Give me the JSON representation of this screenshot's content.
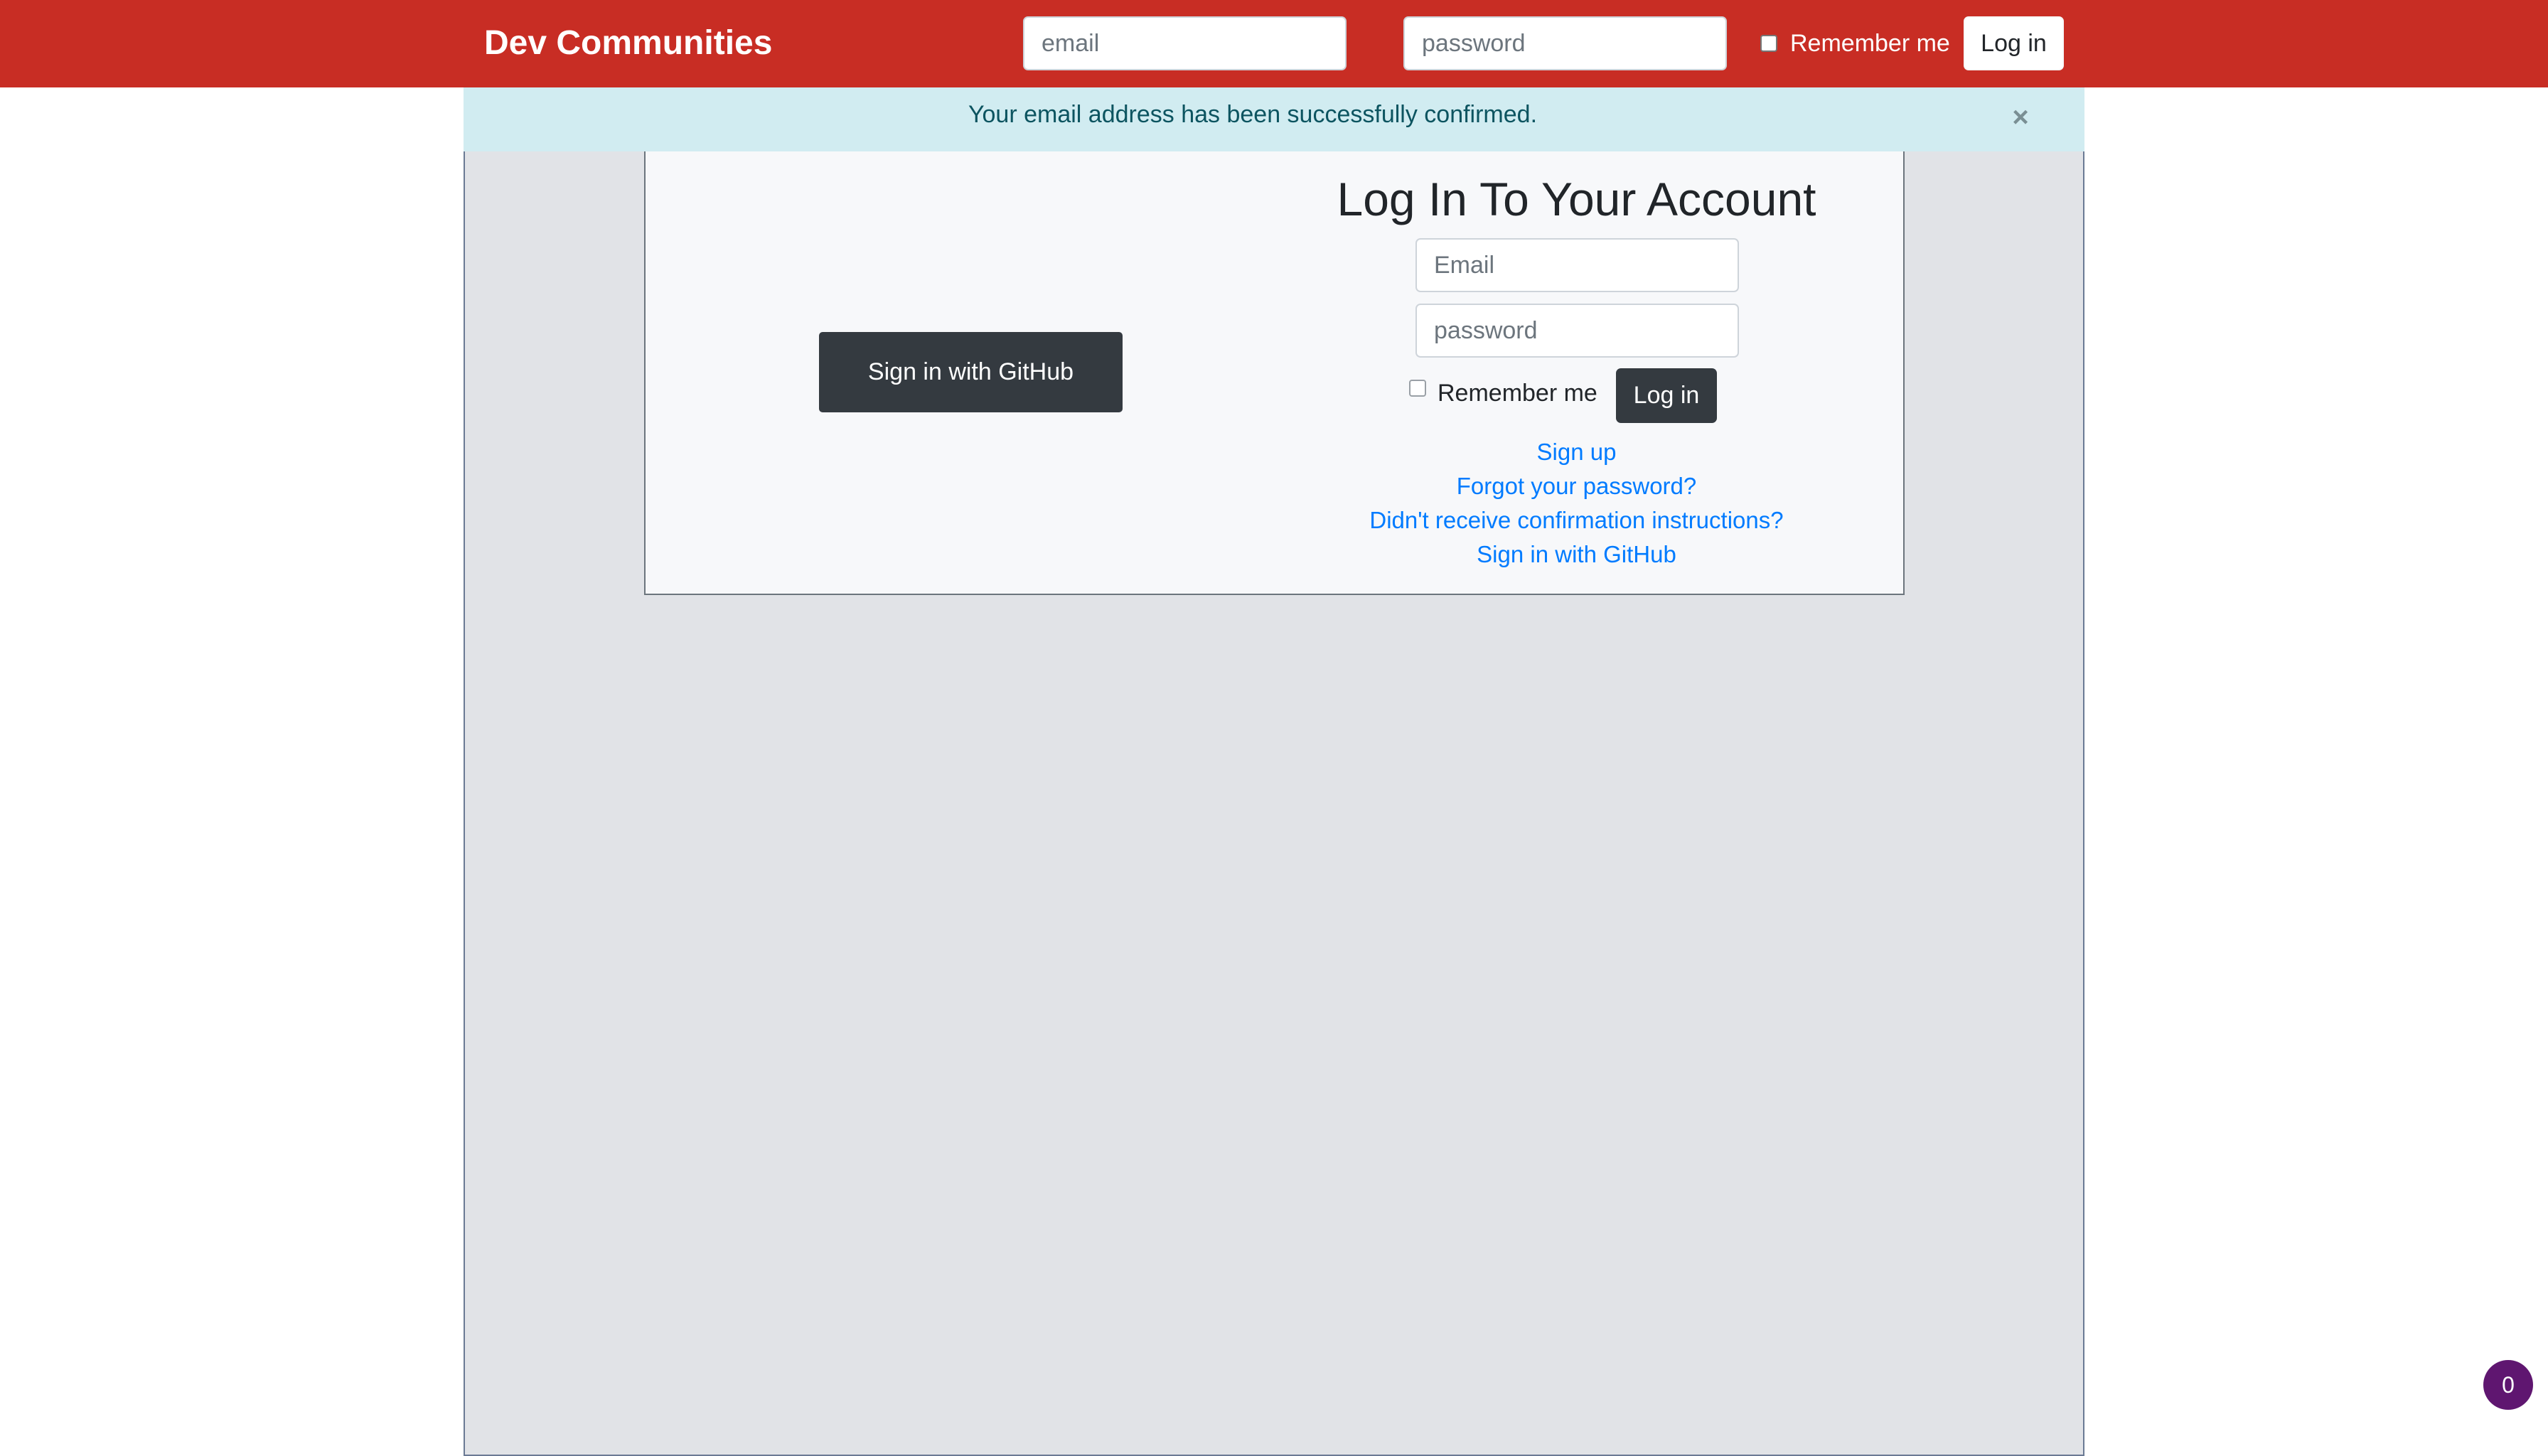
{
  "navbar": {
    "brand": "Dev Communities",
    "email_placeholder": "email",
    "password_placeholder": "password",
    "remember_label": "Remember me",
    "login_label": "Log in"
  },
  "alert": {
    "message": "Your email address has been successfully confirmed.",
    "close_glyph": "×"
  },
  "login_card": {
    "github_button": "Sign in with GitHub",
    "title": "Log In To Your Account",
    "email_placeholder": "Email",
    "password_placeholder": "password",
    "remember_label": "Remember me",
    "login_label": "Log in",
    "links": [
      "Sign up",
      "Forgot your password?",
      "Didn't receive confirmation instructions?",
      "Sign in with GitHub"
    ]
  },
  "badge": {
    "count": "0"
  },
  "colors": {
    "navbar_bg": "#c82d24",
    "alert_bg": "#d1ecf1",
    "alert_text": "#0c5460",
    "main_bg": "#e1e3e7",
    "dark_button": "#343a40",
    "link": "#007bff",
    "badge_bg": "#5f1670"
  },
  "icons": {
    "alert_close": "close-icon"
  }
}
